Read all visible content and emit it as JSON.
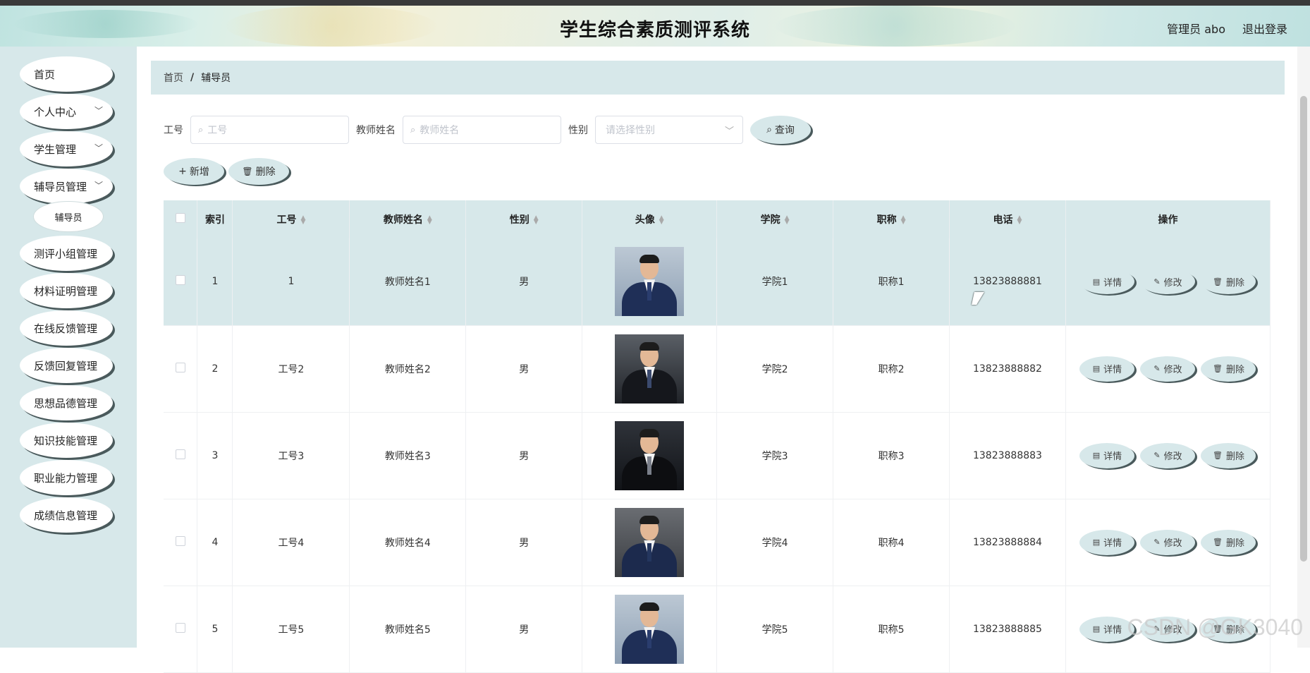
{
  "app": {
    "title": "学生综合素质测评系统"
  },
  "user": {
    "name": "管理员 abo",
    "logout": "退出登录"
  },
  "sidebar": {
    "items": [
      {
        "label": "首页",
        "has_arrow": false
      },
      {
        "label": "个人中心",
        "has_arrow": true
      },
      {
        "label": "学生管理",
        "has_arrow": true
      },
      {
        "label": "辅导员管理",
        "has_arrow": true
      },
      {
        "label": "测评小组管理",
        "has_arrow": false
      },
      {
        "label": "材料证明管理",
        "has_arrow": false
      },
      {
        "label": "在线反馈管理",
        "has_arrow": false
      },
      {
        "label": "反馈回复管理",
        "has_arrow": false
      },
      {
        "label": "思想品德管理",
        "has_arrow": false
      },
      {
        "label": "知识技能管理",
        "has_arrow": false
      },
      {
        "label": "职业能力管理",
        "has_arrow": false
      },
      {
        "label": "成绩信息管理",
        "has_arrow": false
      }
    ],
    "submenu": {
      "label": "辅导员"
    }
  },
  "breadcrumb": {
    "home": "首页",
    "sep": "/",
    "current": "辅导员"
  },
  "search": {
    "gonghao_label": "工号",
    "gonghao_placeholder": "工号",
    "name_label": "教师姓名",
    "name_placeholder": "教师姓名",
    "gender_label": "性别",
    "gender_placeholder": "请选择性别",
    "query": "查询"
  },
  "actions": {
    "add": "新增",
    "delete": "删除"
  },
  "table": {
    "headers": [
      "索引",
      "工号",
      "教师姓名",
      "性别",
      "头像",
      "学院",
      "职称",
      "电话",
      "操作"
    ],
    "rows": [
      {
        "index": "1",
        "gonghao": "1",
        "name": "教师姓名1",
        "gender": "男",
        "college": "学院1",
        "title": "职称1",
        "phone": "13823888881"
      },
      {
        "index": "2",
        "gonghao": "工号2",
        "name": "教师姓名2",
        "gender": "男",
        "college": "学院2",
        "title": "职称2",
        "phone": "13823888882"
      },
      {
        "index": "3",
        "gonghao": "工号3",
        "name": "教师姓名3",
        "gender": "男",
        "college": "学院3",
        "title": "职称3",
        "phone": "13823888883"
      },
      {
        "index": "4",
        "gonghao": "工号4",
        "name": "教师姓名4",
        "gender": "男",
        "college": "学院4",
        "title": "职称4",
        "phone": "13823888884"
      },
      {
        "index": "5",
        "gonghao": "工号5",
        "name": "教师姓名5",
        "gender": "男",
        "college": "学院5",
        "title": "职称5",
        "phone": "13823888885"
      }
    ],
    "ops": {
      "detail": "详情",
      "edit": "修改",
      "delete": "删除"
    }
  },
  "watermark": "CSDN @GK3040"
}
